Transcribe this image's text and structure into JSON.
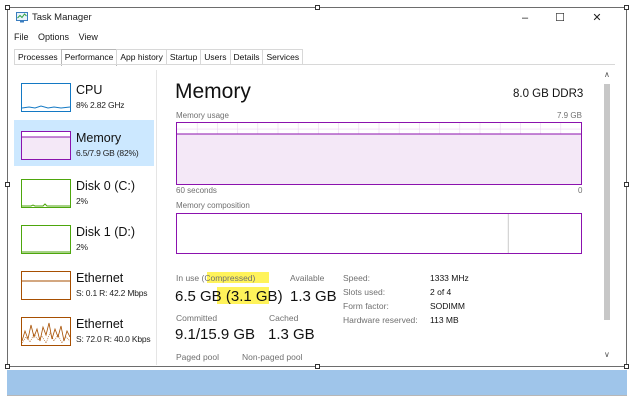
{
  "window": {
    "title": "Task Manager",
    "icons": {
      "app": "task-manager-icon",
      "minimize": "minimize-icon",
      "maximize": "maximize-icon",
      "close": "close-icon"
    },
    "controls": {
      "minimize": "–",
      "maximize": "☐",
      "close": "✕"
    }
  },
  "menu": [
    "File",
    "Options",
    "View"
  ],
  "tabs": [
    {
      "label": "Processes",
      "active": false
    },
    {
      "label": "Performance",
      "active": true
    },
    {
      "label": "App history",
      "active": false
    },
    {
      "label": "Startup",
      "active": false
    },
    {
      "label": "Users",
      "active": false
    },
    {
      "label": "Details",
      "active": false
    },
    {
      "label": "Services",
      "active": false
    }
  ],
  "sidebar": {
    "items": [
      {
        "name": "CPU",
        "sub": "8% 2.82 GHz",
        "selected": false,
        "color": "#1479c4"
      },
      {
        "name": "Memory",
        "sub": "6.5/7.9 GB (82%)",
        "selected": true,
        "color": "#8b12ae"
      },
      {
        "name": "Disk 0 (C:)",
        "sub": "2%",
        "selected": false,
        "color": "#4da60c"
      },
      {
        "name": "Disk 1 (D:)",
        "sub": "2%",
        "selected": false,
        "color": "#4da60c"
      },
      {
        "name": "Ethernet",
        "sub": "S: 0.1  R: 42.2 Mbps",
        "selected": false,
        "color": "#a74f01"
      },
      {
        "name": "Ethernet",
        "sub": "S: 72.0  R: 40.0 Kbps",
        "selected": false,
        "color": "#a74f01"
      }
    ]
  },
  "memory": {
    "title": "Memory",
    "spec": "8.0 GB DDR3",
    "usage_label": "Memory usage",
    "usage_max": "7.9 GB",
    "usage_fraction": 0.82,
    "time_left": "60 seconds",
    "time_right": "0",
    "composition_label": "Memory composition",
    "composition_in_use_fraction": 0.82,
    "stats": {
      "in_use_label_prefix": "In use (Co",
      "in_use_label_highlight": "mpressed)",
      "in_use_value": "6.5 GB (",
      "compressed_value": "3.1 GB",
      "in_use_close": ")",
      "available_label": "Available",
      "available_value": "1.3 GB",
      "committed_label": "Committed",
      "committed_value": "9.1/15.9 GB",
      "cached_label": "Cached",
      "cached_value": "1.3 GB",
      "paged_pool_label": "Paged pool",
      "non_paged_pool_label": "Non-paged pool"
    },
    "specs": [
      {
        "label": "Speed:",
        "value": "1333 MHz"
      },
      {
        "label": "Slots used:",
        "value": "2 of 4"
      },
      {
        "label": "Form factor:",
        "value": "SODIMM"
      },
      {
        "label": "Hardware reserved:",
        "value": "113 MB"
      }
    ]
  },
  "colors": {
    "memory_accent": "#8b12ae",
    "memory_fill": "#f4e8f7",
    "selected_bg": "#cce8ff",
    "highlight": "#fff35a",
    "bottom_band": "#9fc5ea"
  }
}
